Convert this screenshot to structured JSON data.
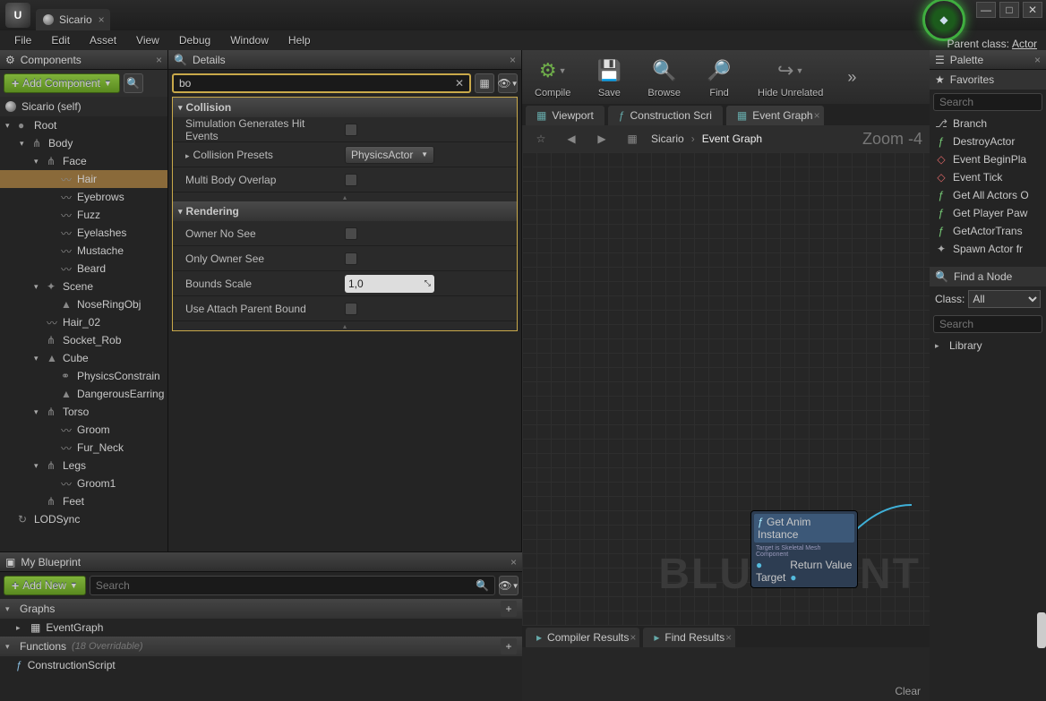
{
  "window": {
    "tab_title": "Sicario",
    "parent_class_label": "Parent class:",
    "parent_class": "Actor"
  },
  "menubar": [
    "File",
    "Edit",
    "Asset",
    "View",
    "Debug",
    "Window",
    "Help"
  ],
  "components": {
    "tab": "Components",
    "add_button": "Add Component",
    "root_label": "Sicario (self)",
    "tree": [
      {
        "label": "Root",
        "depth": 0,
        "icon": "sphere",
        "expandable": true,
        "expanded": true
      },
      {
        "label": "Body",
        "depth": 1,
        "icon": "bone",
        "expandable": true,
        "expanded": true
      },
      {
        "label": "Face",
        "depth": 2,
        "icon": "bone",
        "expandable": true,
        "expanded": true
      },
      {
        "label": "Hair",
        "depth": 3,
        "icon": "mesh",
        "selected": true
      },
      {
        "label": "Eyebrows",
        "depth": 3,
        "icon": "mesh"
      },
      {
        "label": "Fuzz",
        "depth": 3,
        "icon": "mesh"
      },
      {
        "label": "Eyelashes",
        "depth": 3,
        "icon": "mesh"
      },
      {
        "label": "Mustache",
        "depth": 3,
        "icon": "mesh"
      },
      {
        "label": "Beard",
        "depth": 3,
        "icon": "mesh"
      },
      {
        "label": "Scene",
        "depth": 2,
        "icon": "scene",
        "expandable": true,
        "expanded": true
      },
      {
        "label": "NoseRingObj",
        "depth": 3,
        "icon": "static"
      },
      {
        "label": "Hair_02",
        "depth": 2,
        "icon": "mesh"
      },
      {
        "label": "Socket_Rob",
        "depth": 2,
        "icon": "bone"
      },
      {
        "label": "Cube",
        "depth": 2,
        "icon": "static",
        "expandable": true,
        "expanded": true
      },
      {
        "label": "PhysicsConstrain",
        "depth": 3,
        "icon": "physics"
      },
      {
        "label": "DangerousEarring",
        "depth": 3,
        "icon": "static"
      },
      {
        "label": "Torso",
        "depth": 2,
        "icon": "bone",
        "expandable": true,
        "expanded": true
      },
      {
        "label": "Groom",
        "depth": 3,
        "icon": "mesh"
      },
      {
        "label": "Fur_Neck",
        "depth": 3,
        "icon": "mesh"
      },
      {
        "label": "Legs",
        "depth": 2,
        "icon": "bone",
        "expandable": true,
        "expanded": true
      },
      {
        "label": "Groom1",
        "depth": 3,
        "icon": "mesh"
      },
      {
        "label": "Feet",
        "depth": 2,
        "icon": "bone"
      },
      {
        "label": "LODSync",
        "depth": 0,
        "icon": "sync"
      }
    ]
  },
  "details": {
    "tab": "Details",
    "search_value": "bo",
    "categories": [
      {
        "name": "Collision",
        "rows": [
          {
            "label": "Simulation Generates Hit Events",
            "type": "check",
            "value": false
          },
          {
            "label": "Collision Presets",
            "type": "dropdown",
            "value": "PhysicsActor",
            "expandable": true
          },
          {
            "label": "Multi Body Overlap",
            "type": "check",
            "value": false
          }
        ]
      },
      {
        "name": "Rendering",
        "rows": [
          {
            "label": "Owner No See",
            "type": "check",
            "value": false
          },
          {
            "label": "Only Owner See",
            "type": "check",
            "value": false
          },
          {
            "label": "Bounds Scale",
            "type": "spin",
            "value": "1,0"
          },
          {
            "label": "Use Attach Parent Bound",
            "type": "check",
            "value": false
          }
        ]
      }
    ]
  },
  "toolbar": [
    {
      "label": "Compile",
      "icon": "gear",
      "color": "#6fae4a",
      "drop": true
    },
    {
      "label": "Save",
      "icon": "save",
      "color": "#4a7ab8"
    },
    {
      "label": "Browse",
      "icon": "browse",
      "color": "#888"
    },
    {
      "label": "Find",
      "icon": "find",
      "color": "#888"
    },
    {
      "label": "Hide Unrelated",
      "icon": "hide",
      "color": "#888",
      "drop": true
    }
  ],
  "graph_tabs": [
    {
      "label": "Viewport",
      "icon": "grid"
    },
    {
      "label": "Construction Scri",
      "icon": "func"
    },
    {
      "label": "Event Graph",
      "icon": "grid",
      "active": true
    }
  ],
  "graph": {
    "breadcrumb_root": "Sicario",
    "breadcrumb_leaf": "Event Graph",
    "zoom": "Zoom -4",
    "watermark": "BLUEPRINT",
    "node_title": "Get Anim Instance",
    "node_sub": "Target is Skeletal Mesh Component",
    "node_in": "Target",
    "node_out": "Return Value"
  },
  "bottom_tabs": [
    {
      "label": "Compiler Results"
    },
    {
      "label": "Find Results"
    }
  ],
  "clear_label": "Clear",
  "my_blueprint": {
    "tab": "My Blueprint",
    "add": "Add New",
    "search_placeholder": "Search",
    "graphs_header": "Graphs",
    "graphs_item": "EventGraph",
    "functions_header": "Functions",
    "functions_hint": "(18 Overridable)",
    "functions_item": "ConstructionScript"
  },
  "palette": {
    "tab": "Palette",
    "favorites": "Favorites",
    "search_placeholder": "Search",
    "items": [
      {
        "label": "Branch",
        "icon": "branch"
      },
      {
        "label": "DestroyActor",
        "icon": "func"
      },
      {
        "label": "Event BeginPla",
        "icon": "event"
      },
      {
        "label": "Event Tick",
        "icon": "event"
      },
      {
        "label": "Get All Actors O",
        "icon": "func"
      },
      {
        "label": "Get Player Paw",
        "icon": "func"
      },
      {
        "label": "GetActorTrans",
        "icon": "func"
      },
      {
        "label": "Spawn Actor fr",
        "icon": "spawn"
      }
    ],
    "find_node": "Find a Node",
    "class_label": "Class:",
    "class_value": "All",
    "library": "Library"
  }
}
